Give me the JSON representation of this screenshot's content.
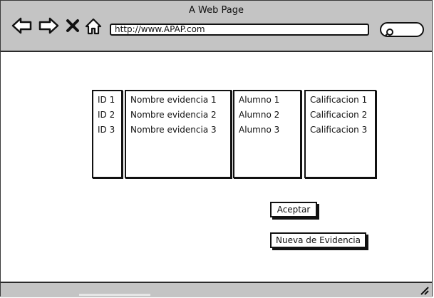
{
  "window": {
    "title": "A Web Page"
  },
  "browser": {
    "url": "http://www.APAP.com",
    "icons": [
      "back-arrow-icon",
      "forward-arrow-icon",
      "close-x-icon",
      "home-icon",
      "search-icon"
    ]
  },
  "table": {
    "columns": [
      {
        "key": "id",
        "cells": [
          "ID 1",
          "ID 2",
          "ID 3"
        ]
      },
      {
        "key": "evidencia",
        "cells": [
          "Nombre evidencia 1",
          "Nombre evidencia 2",
          "Nombre evidencia 3"
        ]
      },
      {
        "key": "alumno",
        "cells": [
          "Alumno 1",
          "Alumno 2",
          "Alumno 3"
        ]
      },
      {
        "key": "calificacion",
        "cells": [
          "Calificacion 1",
          "Calificacion 2",
          "Calificacion 3"
        ]
      }
    ]
  },
  "actions": {
    "accept_label": "Aceptar",
    "new_evidence_label": "Nueva de Evidencia"
  },
  "colors": {
    "chrome": "#c4c4c4",
    "stroke": "#111111",
    "page": "#ffffff"
  }
}
